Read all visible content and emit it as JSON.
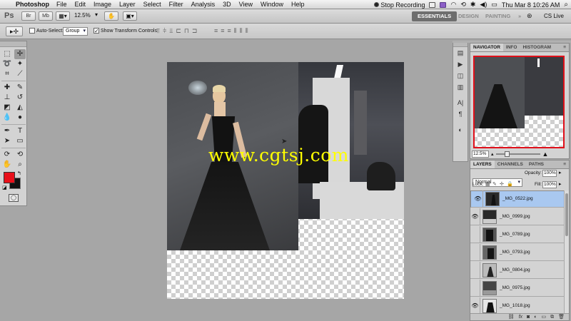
{
  "menubar": {
    "apple": "",
    "app": "Photoshop",
    "items": [
      "File",
      "Edit",
      "Image",
      "Layer",
      "Select",
      "Filter",
      "Analysis",
      "3D",
      "View",
      "Window",
      "Help"
    ],
    "stop_recording": "Stop Recording",
    "clock": "Thu Mar 8  10:26 AM"
  },
  "appbar": {
    "logo": "Ps",
    "zoom": "12.5%",
    "workspaces": [
      "ESSENTIALS",
      "DESIGN",
      "PAINTING"
    ],
    "active_workspace": "ESSENTIALS",
    "more": "»",
    "cs_live": "CS Live"
  },
  "options": {
    "auto_select_label": "Auto-Select:",
    "auto_select_checked": false,
    "auto_select_target": "Group",
    "show_transform_label": "Show Transform Controls",
    "show_transform_checked": true
  },
  "canvas": {
    "watermark": "www.cgtsj.com"
  },
  "navigator": {
    "tabs": [
      "NAVIGATOR",
      "INFO",
      "HISTOGRAM"
    ],
    "active_tab": "NAVIGATOR",
    "zoom": "12.5%",
    "zoom_slider_position": 0.2
  },
  "layers_panel": {
    "tabs": [
      "LAYERS",
      "CHANNELS",
      "PATHS"
    ],
    "active_tab": "LAYERS",
    "blend_mode": "Normal",
    "opacity_label": "Opacity:",
    "opacity": "100%",
    "lock_label": "Lock:",
    "fill_label": "Fill:",
    "fill": "100%",
    "layers": [
      {
        "name": "_MG_0522.jpg",
        "visible": true,
        "selected": true
      },
      {
        "name": "_MG_0999.jpg",
        "visible": true,
        "selected": false
      },
      {
        "name": "_MG_0789.jpg",
        "visible": false,
        "selected": false
      },
      {
        "name": "_MG_0793.jpg",
        "visible": false,
        "selected": false
      },
      {
        "name": "_MG_0804.jpg",
        "visible": false,
        "selected": false
      },
      {
        "name": "_MG_0975.jpg",
        "visible": false,
        "selected": false
      },
      {
        "name": "_MG_1018.jpg",
        "visible": true,
        "selected": false
      }
    ],
    "footer_icons": [
      "link-icon",
      "fx-icon",
      "mask-icon",
      "adjustment-icon",
      "folder-icon",
      "new-layer-icon",
      "trash-icon"
    ]
  },
  "colors": {
    "foreground": "#e8101a",
    "background": "#111111",
    "selection": "#a9c8f0",
    "watermark": "#ffff00"
  }
}
